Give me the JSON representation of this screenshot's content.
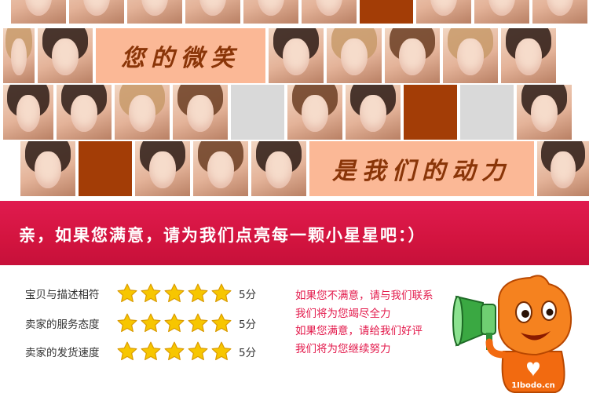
{
  "collage": {
    "slogan_top": "您的微笑",
    "slogan_bottom": "是我们的动力"
  },
  "banner": {
    "text": "亲，如果您满意，请为我们点亮每一颗小星星吧：）"
  },
  "ratings": [
    {
      "label": "宝贝与描述相符",
      "stars": 5,
      "score": "5分"
    },
    {
      "label": "卖家的服务态度",
      "stars": 5,
      "score": "5分"
    },
    {
      "label": "卖家的发货速度",
      "stars": 5,
      "score": "5分"
    }
  ],
  "note": {
    "lines": [
      "如果您不满意，请与我们联系",
      "我们将为您竭尽全力",
      "如果您满意，请给我们好评",
      "我们将为您继续努力"
    ]
  },
  "mascot": {
    "shirt_text": "1Ibodo.cn"
  },
  "colors": {
    "banner": "#d3143f",
    "slogan_bg": "#fbb896",
    "slogan_text": "#8a3508",
    "rust_tile": "#a33d06",
    "grey_tile": "#d9d9d9",
    "note_text": "#e3194b",
    "star": "#f7c600",
    "mascot": "#f26a10",
    "megaphone": "#3aa842"
  }
}
